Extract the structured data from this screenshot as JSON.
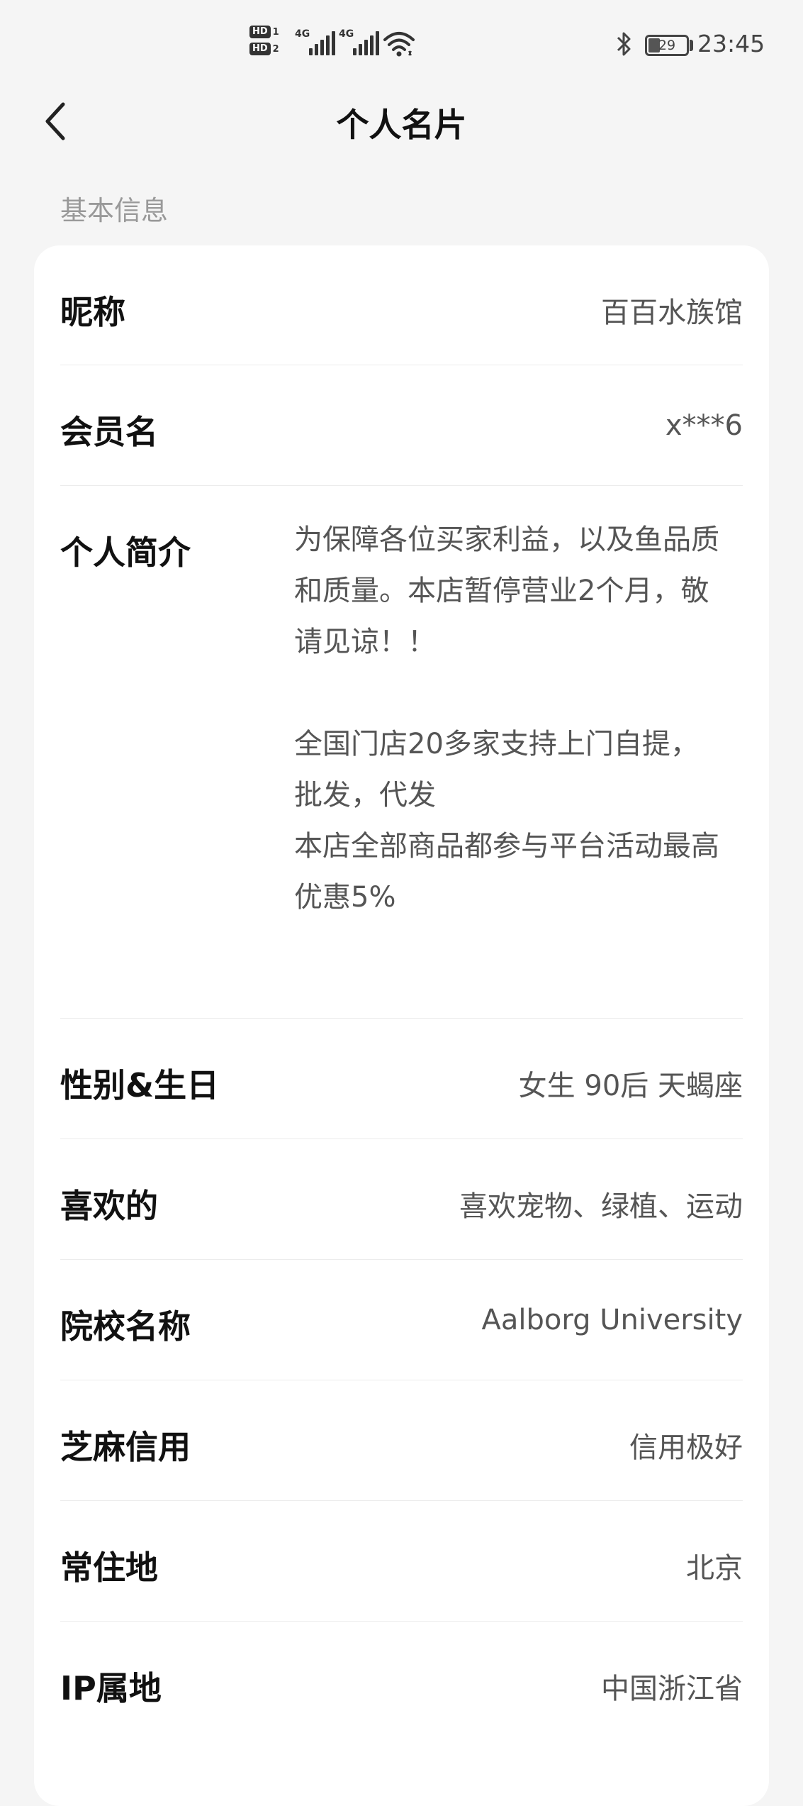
{
  "status_bar": {
    "sim1": {
      "badge": "HD",
      "num": "1"
    },
    "sim2": {
      "badge": "HD",
      "num": "2"
    },
    "signal1_tag": "4G",
    "signal2_tag": "4G",
    "battery": "29",
    "time": "23:45"
  },
  "header": {
    "title": "个人名片"
  },
  "section": {
    "label": "基本信息"
  },
  "rows": [
    {
      "label": "昵称",
      "value": "百百水族馆"
    },
    {
      "label": "会员名",
      "value": "x***6"
    },
    {
      "label": "个人简介",
      "value": ""
    },
    {
      "label": "性别&生日",
      "value": "女生 90后 天蝎座"
    },
    {
      "label": "喜欢的",
      "value": "喜欢宠物、绿植、运动"
    },
    {
      "label": "院校名称",
      "value": "Aalborg University"
    },
    {
      "label": "芝麻信用",
      "value": "信用极好"
    },
    {
      "label": "常住地",
      "value": "北京"
    },
    {
      "label": "IP属地",
      "value": "中国浙江省"
    }
  ],
  "bio": {
    "line1": "为保障各位买家利益，以及鱼品质",
    "line2": "和质量。本店暂停营业2个月，敬",
    "line3": "请见谅！！",
    "line4": "全国门店20多家支持上门自提，",
    "line5": "批发，代发",
    "line6": "本店全部商品都参与平台活动最高",
    "line7": "优惠5%"
  },
  "icons": {
    "back": "back-arrow-icon",
    "wifi": "wifi-icon",
    "bluetooth": "bluetooth-icon",
    "battery": "battery-icon"
  }
}
